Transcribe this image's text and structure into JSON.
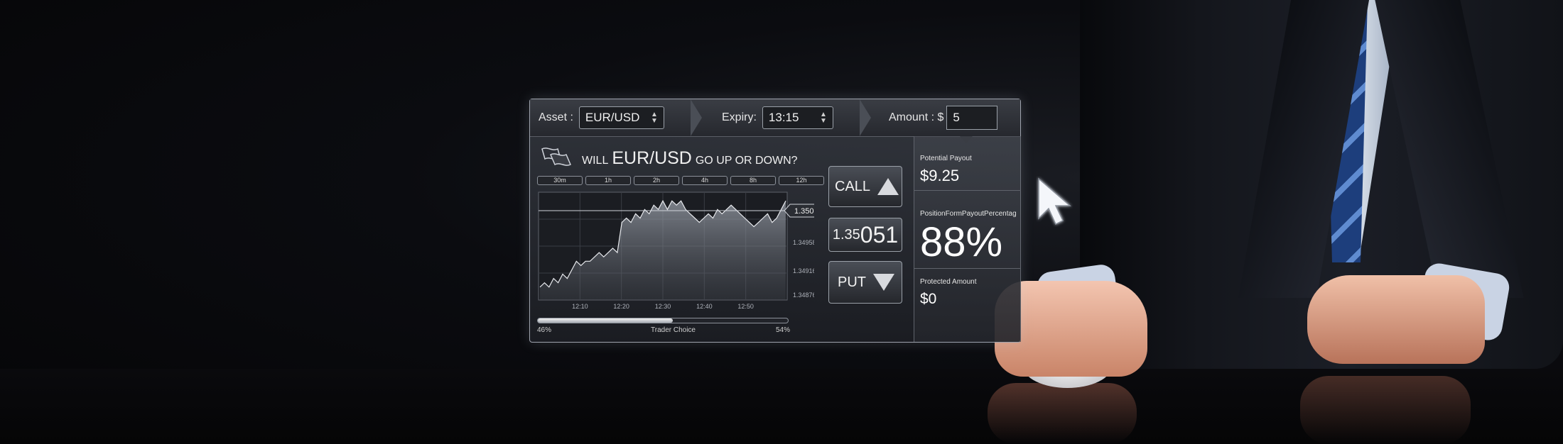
{
  "header": {
    "asset_label": "Asset :",
    "asset_value": "EUR/USD",
    "expiry_label": "Expiry:",
    "expiry_value": "13:15",
    "amount_label": "Amount : $",
    "amount_value": "5"
  },
  "question": {
    "prefix": "WILL",
    "asset": "EUR/USD",
    "suffix": "GO UP OR DOWN?"
  },
  "timeframes": [
    "30m",
    "1h",
    "2h",
    "4h",
    "8h",
    "12h"
  ],
  "chart_data": {
    "type": "area",
    "x_ticks": [
      "12:10",
      "12:20",
      "12:30",
      "12:40",
      "12:50"
    ],
    "y_ticks": [
      "1.34958",
      "1.34916",
      "1.34876"
    ],
    "current_price": "1.35051",
    "series": [
      {
        "values": [
          1.3485,
          1.3486,
          1.3485,
          1.3487,
          1.3486,
          1.3488,
          1.3487,
          1.3489,
          1.3491,
          1.349,
          1.3491,
          1.3491,
          1.3492,
          1.3493,
          1.3492,
          1.3493,
          1.3494,
          1.3493,
          1.35,
          1.3501,
          1.35,
          1.3502,
          1.3501,
          1.3503,
          1.3502,
          1.3504,
          1.3503,
          1.3505,
          1.3503,
          1.3505,
          1.3504,
          1.3505,
          1.3503,
          1.3502,
          1.3501,
          1.35,
          1.3501,
          1.3502,
          1.3501,
          1.3503,
          1.3502,
          1.3503,
          1.3504,
          1.3503,
          1.3502,
          1.3501,
          1.35,
          1.3499,
          1.35,
          1.3501,
          1.3502,
          1.35,
          1.3501,
          1.3503,
          1.3505
        ]
      }
    ]
  },
  "trade": {
    "call_label": "CALL",
    "price_small": "1.35",
    "price_big": "051",
    "put_label": "PUT"
  },
  "footer": {
    "left_pct": "46%",
    "center_label": "Trader Choice",
    "right_pct": "54%",
    "call_share": 0.54
  },
  "side": {
    "payout_label": "Potential Payout",
    "payout_value": "$9.25",
    "percent_label": "PositionFormPayoutPercentag",
    "percent_value": "88%",
    "protected_label": "Protected Amount",
    "protected_value": "$0"
  },
  "colors": {
    "accent": "#d8dade",
    "panel_border": "#9ea3ad"
  }
}
